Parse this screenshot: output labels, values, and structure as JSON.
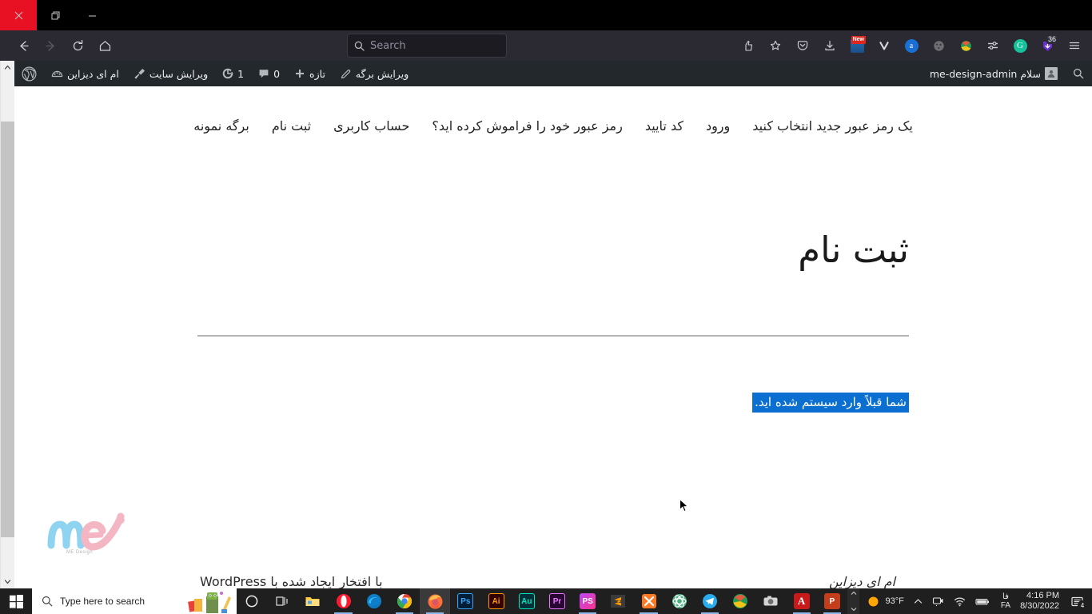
{
  "window": {
    "minimize_label": "Minimize",
    "restore_label": "Restore",
    "close_label": "Close"
  },
  "browser": {
    "back_label": "Back",
    "forward_label": "Forward",
    "reload_label": "Reload",
    "home_label": "Home",
    "search": {
      "placeholder": "Search",
      "value": ""
    },
    "toolbar_icons": [
      {
        "name": "pocket-save-icon",
        "glyph": "save"
      },
      {
        "name": "bookmark-star-icon",
        "glyph": "star"
      },
      {
        "name": "pocket-icon",
        "glyph": "pocket"
      },
      {
        "name": "downloads-icon",
        "glyph": "download"
      },
      {
        "name": "news-extension-icon",
        "glyph": "news",
        "badge": "New"
      },
      {
        "name": "vimeo-extension-icon",
        "glyph": "v"
      },
      {
        "name": "adblock-extension-icon",
        "glyph": "a"
      },
      {
        "name": "cookie-extension-icon",
        "glyph": "cookie"
      },
      {
        "name": "idm-extension-icon",
        "glyph": "idm"
      },
      {
        "name": "proxy-extension-icon",
        "glyph": "proxy"
      },
      {
        "name": "grammarly-extension-icon",
        "glyph": "G"
      },
      {
        "name": "download-manager-icon",
        "glyph": "arrow",
        "badge": "36"
      },
      {
        "name": "app-menu-icon",
        "glyph": "menu"
      }
    ]
  },
  "adminbar": {
    "search_label": "جستجو",
    "greeting": "سلام me-design-admin",
    "wp_logo_label": "WordPress",
    "site_name": "ام ای دیزاین",
    "customize_label": "ویرایش سایت",
    "updates_count": "1",
    "comments_count": "0",
    "new_label": "تازه",
    "edit_page_label": "ویرایش برگه"
  },
  "site": {
    "nav_items": [
      {
        "label": "برگه نمونه",
        "name": "nav-sample-page"
      },
      {
        "label": "ثبت نام",
        "name": "nav-register"
      },
      {
        "label": "حساب کاربری",
        "name": "nav-account"
      },
      {
        "label": "رمز عبور خود را فراموش کرده اید؟",
        "name": "nav-forgot-password"
      },
      {
        "label": "کد تایید",
        "name": "nav-verification-code"
      },
      {
        "label": "ورود",
        "name": "nav-login"
      },
      {
        "label": "یک رمز عبور جدید انتخاب کنید",
        "name": "nav-choose-new-password"
      }
    ],
    "page_title": "ثبت نام",
    "notice_text": "شما قبلاً وارد سیستم شده اید.",
    "logo_text": "ME Design",
    "footer_credits": "با افتخار ایجاد شده با WordPress",
    "footer_sitename": "ام ای دیزاین"
  },
  "colors": {
    "selection_blue": "#0b6ed1",
    "adminbar_bg": "#23282d",
    "browser_chrome": "#2b2a33",
    "logo_blue": "#8ed3f0",
    "logo_pink": "#f5b6c4"
  },
  "taskbar": {
    "start_label": "Start",
    "search_placeholder": "Type here to search",
    "cortana_label": "Cortana",
    "taskview_label": "Task View",
    "apps": [
      {
        "name": "taskbar-file-explorer",
        "label": "File Explorer",
        "color": "#ffc83d",
        "glyph": "folder",
        "running": false
      },
      {
        "name": "taskbar-opera",
        "label": "Opera",
        "color": "#ff1b2d",
        "glyph": "O",
        "running": true
      },
      {
        "name": "taskbar-edge",
        "label": "Microsoft Edge",
        "color": "#0f7ec8",
        "glyph": "e",
        "running": false
      },
      {
        "name": "taskbar-chrome",
        "label": "Google Chrome",
        "color": "#4285f4",
        "glyph": "c",
        "running": true
      },
      {
        "name": "taskbar-firefox",
        "label": "Mozilla Firefox",
        "color": "#ff7139",
        "glyph": "f",
        "running": true,
        "active": true
      },
      {
        "name": "taskbar-photoshop",
        "label": "Adobe Photoshop",
        "color": "#001e36",
        "text": "Ps",
        "textColor": "#31a8ff",
        "running": false
      },
      {
        "name": "taskbar-illustrator",
        "label": "Adobe Illustrator",
        "color": "#330000",
        "text": "Ai",
        "textColor": "#ff9a00",
        "running": false
      },
      {
        "name": "taskbar-audition",
        "label": "Adobe Audition",
        "color": "#00303a",
        "text": "Au",
        "textColor": "#00e4bb",
        "running": false
      },
      {
        "name": "taskbar-premiere",
        "label": "Adobe Premiere Pro",
        "color": "#2a0634",
        "text": "Pr",
        "textColor": "#ea77ff",
        "running": false
      },
      {
        "name": "taskbar-phpstorm",
        "label": "PhpStorm",
        "color": "#b74af7",
        "text": "PS",
        "textColor": "#ffffff",
        "running": true
      },
      {
        "name": "taskbar-sublime",
        "label": "Sublime Text",
        "color": "#3b3b3b",
        "glyph": "s",
        "running": false
      },
      {
        "name": "taskbar-xampp",
        "label": "XAMPP",
        "color": "#fb7a24",
        "glyph": "x",
        "running": true
      },
      {
        "name": "taskbar-atom",
        "label": "Atom",
        "color": "#4caf7d",
        "glyph": "atom",
        "running": false
      },
      {
        "name": "taskbar-telegram",
        "label": "Telegram",
        "color": "#2aabee",
        "glyph": "tg",
        "running": true
      },
      {
        "name": "taskbar-idm",
        "label": "Internet Download Manager",
        "color": "#1f9d55",
        "glyph": "idm",
        "running": false
      },
      {
        "name": "taskbar-camera",
        "label": "Camera",
        "color": "#d6d6d6",
        "glyph": "cam",
        "running": false
      },
      {
        "name": "taskbar-acrobat",
        "label": "Adobe Acrobat",
        "color": "#c81a1a",
        "text": "A",
        "textColor": "#ffffff",
        "running": true
      },
      {
        "name": "taskbar-powerpoint",
        "label": "Microsoft PowerPoint",
        "color": "#c43e1c",
        "text": "P",
        "textColor": "#ffffff",
        "running": true
      }
    ],
    "tray": {
      "temperature": "93°F",
      "lang_native": "فا",
      "lang_code": "FA",
      "time": "4:16 PM",
      "date": "8/30/2022",
      "notification_count": "4"
    }
  }
}
